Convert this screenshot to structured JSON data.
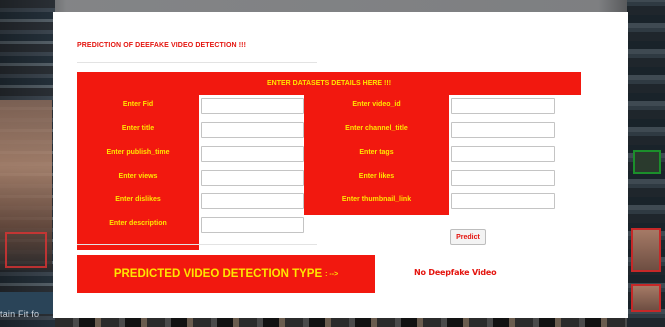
{
  "page": {
    "title": "PREDICTION OF DEEFAKE VIDEO DETECTION !!!"
  },
  "form": {
    "header": "ENTER DATASETS DETAILS HERE !!!",
    "left_fields": [
      {
        "label": "Enter Fid",
        "value": ""
      },
      {
        "label": "Enter title",
        "value": ""
      },
      {
        "label": "Enter publish_time",
        "value": ""
      },
      {
        "label": "Enter views",
        "value": ""
      },
      {
        "label": "Enter dislikes",
        "value": ""
      },
      {
        "label": "Enter description",
        "value": ""
      }
    ],
    "right_fields": [
      {
        "label": "Enter video_id",
        "value": ""
      },
      {
        "label": "Enter channel_title",
        "value": ""
      },
      {
        "label": "Enter tags",
        "value": ""
      },
      {
        "label": "Enter likes",
        "value": ""
      },
      {
        "label": "Enter thumbnail_link",
        "value": ""
      }
    ],
    "predict_label": "Predict"
  },
  "result": {
    "label": "PREDICTED VIDEO DETECTION TYPE",
    "arrow": ": -->",
    "value": "No Deepfake Video"
  },
  "background": {
    "caption": "tain Fit fo"
  },
  "colors": {
    "accent_red": "#f2180f",
    "label_yellow": "#ffe500",
    "page_bg": "#ffffff"
  }
}
